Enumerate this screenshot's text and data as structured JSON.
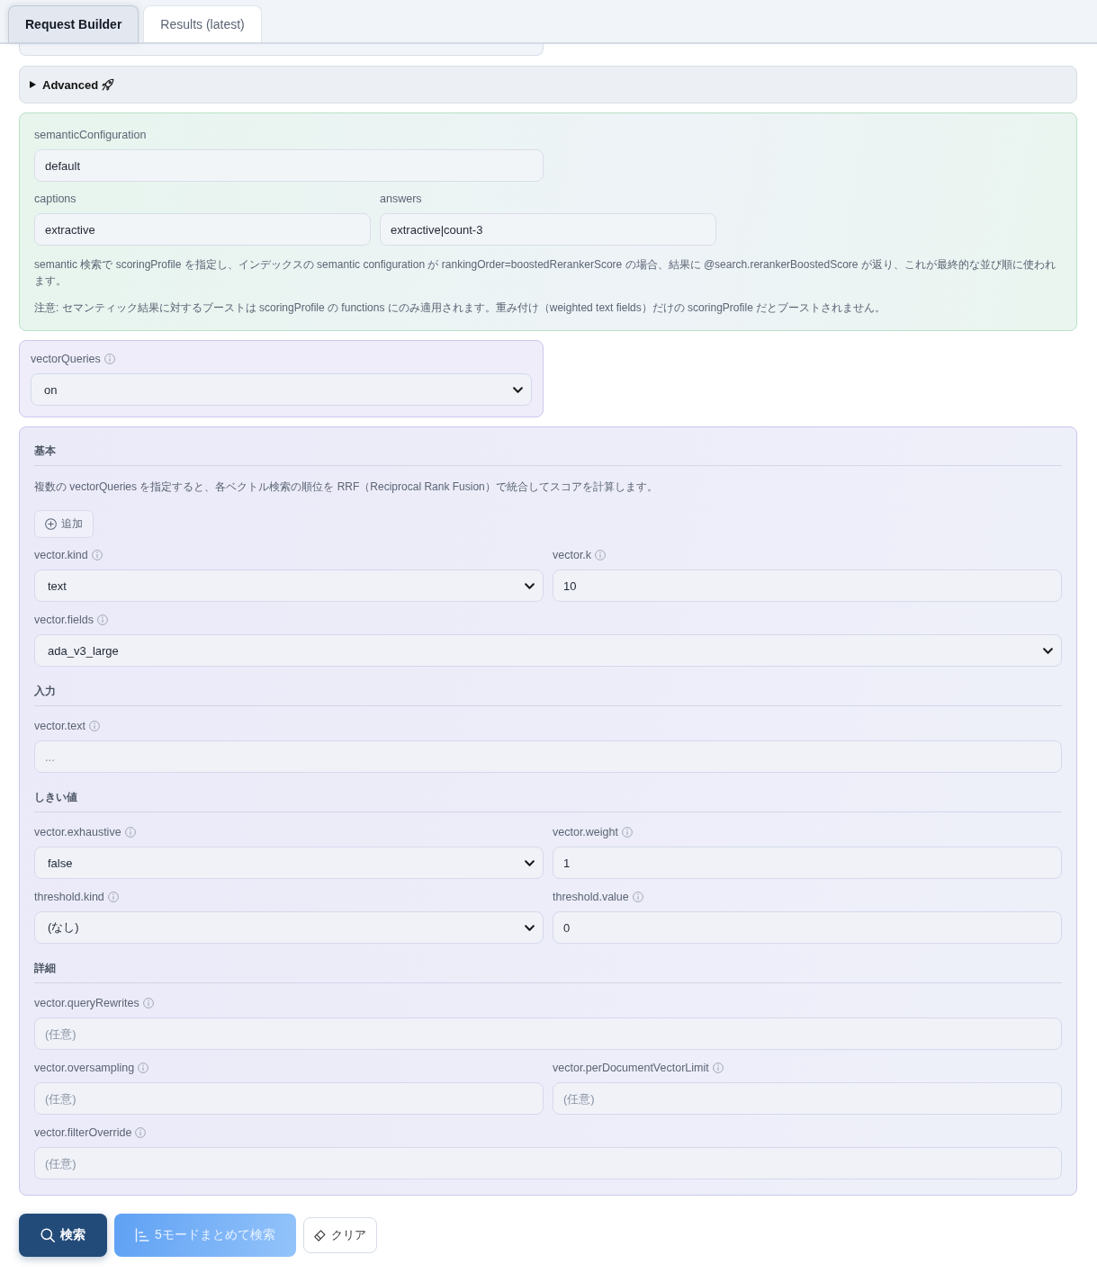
{
  "tabs": [
    {
      "label": "Request Builder",
      "selected": true
    },
    {
      "label": "Results (latest)",
      "selected": false
    }
  ],
  "advanced": {
    "label": "Advanced",
    "expanded": false
  },
  "semantic": {
    "rows": [
      [
        {
          "label": "semanticConfiguration",
          "info": false,
          "kind": "input",
          "value": "default"
        }
      ],
      [
        {
          "label": "captions",
          "info": false,
          "kind": "input",
          "value": "extractive"
        },
        {
          "label": "answers",
          "info": false,
          "kind": "input",
          "value": "extractive|count-3"
        }
      ]
    ],
    "notes": [
      "semantic 検索で scoringProfile を指定し、インデックスの semantic configuration が rankingOrder=boostedRerankerScore の場合、結果に @search.rerankerBoostedScore が返り、これが最終的な並び順に使われます。",
      "注意: セマンティック結果に対するブーストは scoringProfile の functions にのみ適用されます。重み付け（weighted text fields）だけの scoringProfile だとブーストされません。"
    ]
  },
  "vector_queries": {
    "label": "vectorQueries",
    "info": true,
    "kind": "select",
    "value": "on"
  },
  "vector_settings": {
    "sections": [
      {
        "heading": "基本",
        "note": "複数の vectorQueries を指定すると、各ベクトル検索の順位を RRF（Reciprocal Rank Fusion）で統合してスコアを計算します。",
        "add_button": "追加",
        "rows": [
          [
            {
              "label": "vector.kind",
              "info": true,
              "kind": "select",
              "value": "text"
            },
            {
              "label": "vector.k",
              "info": true,
              "kind": "input",
              "value": "10"
            }
          ],
          [
            {
              "label": "vector.fields",
              "info": true,
              "kind": "select",
              "value": "ada_v3_large"
            }
          ]
        ]
      },
      {
        "heading": "入力",
        "rows": [
          [
            {
              "label": "vector.text",
              "info": true,
              "kind": "input",
              "placeholder": "..."
            }
          ]
        ]
      },
      {
        "heading": "しきい値",
        "rows": [
          [
            {
              "label": "vector.exhaustive",
              "info": true,
              "kind": "select",
              "value": "false"
            },
            {
              "label": "vector.weight",
              "info": true,
              "kind": "input",
              "value": "1"
            }
          ],
          [
            {
              "label": "threshold.kind",
              "info": true,
              "kind": "select",
              "value": "(なし)"
            },
            {
              "label": "threshold.value",
              "info": true,
              "kind": "input",
              "value": "0"
            }
          ]
        ]
      },
      {
        "heading": "詳細",
        "rows": [
          [
            {
              "label": "vector.queryRewrites",
              "info": true,
              "kind": "input",
              "placeholder": "(任意)"
            }
          ],
          [
            {
              "label": "vector.oversampling",
              "info": true,
              "kind": "input",
              "placeholder": "(任意)"
            },
            {
              "label": "vector.perDocumentVectorLimit",
              "info": true,
              "kind": "input",
              "placeholder": "(任意)"
            }
          ],
          [
            {
              "label": "vector.filterOverride",
              "info": true,
              "kind": "input",
              "placeholder": "(任意)"
            }
          ]
        ]
      }
    ]
  },
  "actions": [
    {
      "kind": "primary",
      "label": "検索"
    },
    {
      "kind": "gradient",
      "label": "5モードまとめて検索"
    },
    {
      "kind": "outline",
      "label": "クリア"
    }
  ]
}
